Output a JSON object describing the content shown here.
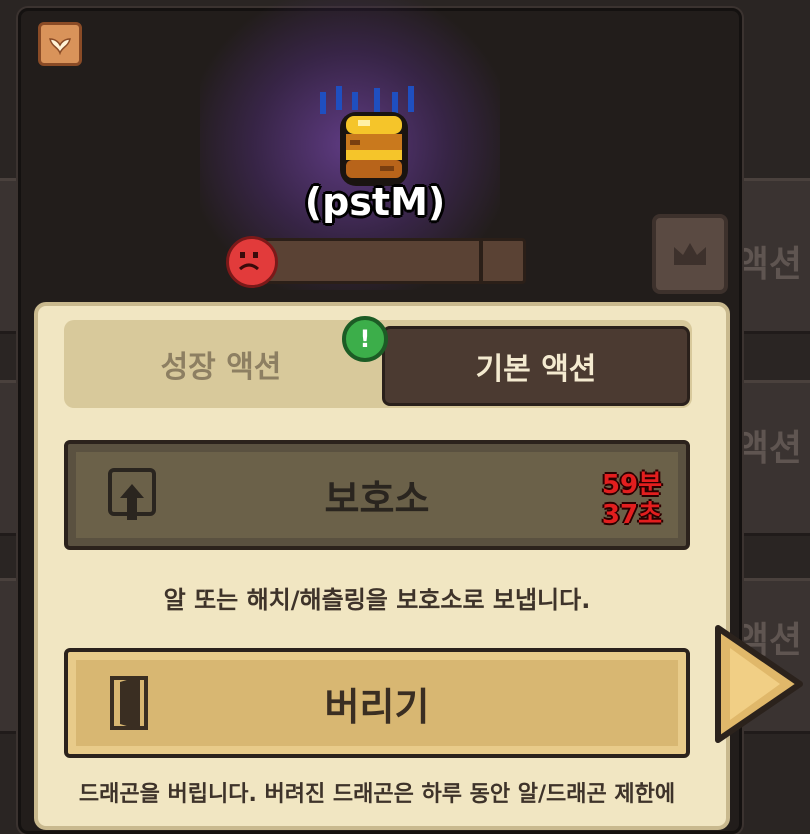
{
  "header": {
    "dragon_name": "(pstM)"
  },
  "tabs": {
    "growth_label": "성장 액션",
    "basic_label": "기본 액션",
    "alert_symbol": "!"
  },
  "actions": {
    "shelter": {
      "label": "보호소",
      "timer_min": "59분",
      "timer_sec": "37초",
      "description": "알 또는 해치/해츨링을 보호소로 보냅니다."
    },
    "abandon": {
      "label": "버리기",
      "description_line1": "드래곤을 버립니다. 버려진 드래곤은 하루 동안 알/드래곤 제한에"
    }
  },
  "background": {
    "row_label": "액션"
  },
  "colors": {
    "accent_cream": "#f1e6c2",
    "alert_green": "#3cae4a",
    "timer_red": "#e31e1e",
    "mood_red": "#e23b3b"
  },
  "icons": [
    "wings-icon",
    "crown-icon",
    "shelter-upload-icon",
    "door-exit-icon",
    "sad-face-icon",
    "next-arrow-icon"
  ]
}
